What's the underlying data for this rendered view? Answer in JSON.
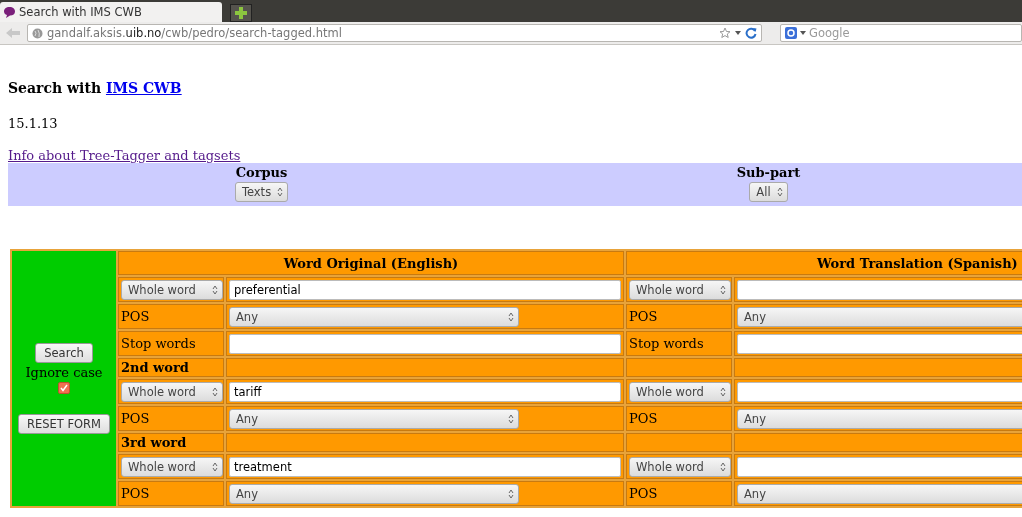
{
  "browser": {
    "tab_title": "Search with IMS CWB",
    "url_host_pre": "gandalf.aksis.",
    "url_host_main": "uib.no",
    "url_path": "/cwb/pedro/search-tagged.html",
    "search_placeholder": "Google"
  },
  "page": {
    "title_text": "Search with",
    "title_link": "IMS CWB",
    "date": "15.1.13",
    "info_link": "Info about Tree-Tagger and tagsets"
  },
  "selection": [
    {
      "label": "Corpus",
      "value": "Texts"
    },
    {
      "label": "Sub-part",
      "value": "All"
    }
  ],
  "form": {
    "search_button": "Search",
    "ignore_case": {
      "label": "Ignore case",
      "checked": true
    },
    "reset_button": "RESET FORM",
    "columns": [
      {
        "title": "Word Original (English)"
      },
      {
        "title": "Word Translation (Spanish)"
      }
    ],
    "words": [
      {
        "original": {
          "match": "Whole word",
          "value": "preferential",
          "pos_label": "POS",
          "pos": "Any",
          "stop_label": "Stop words"
        },
        "translation": {
          "match": "Whole word",
          "pos_label": "POS",
          "pos": "Any",
          "stop_label": "Stop words"
        }
      },
      {
        "heading": "2nd word",
        "original": {
          "match": "Whole word",
          "value": "tariff",
          "pos_label": "POS",
          "pos": "Any"
        },
        "translation": {
          "match": "Whole word",
          "pos_label": "POS",
          "pos": "Any"
        }
      },
      {
        "heading": "3rd word",
        "original": {
          "match": "Whole word",
          "value": "treatment",
          "pos_label": "POS",
          "pos": "Any"
        },
        "translation": {
          "match": "Whole word",
          "pos_label": "POS",
          "pos": "Any"
        }
      }
    ]
  }
}
